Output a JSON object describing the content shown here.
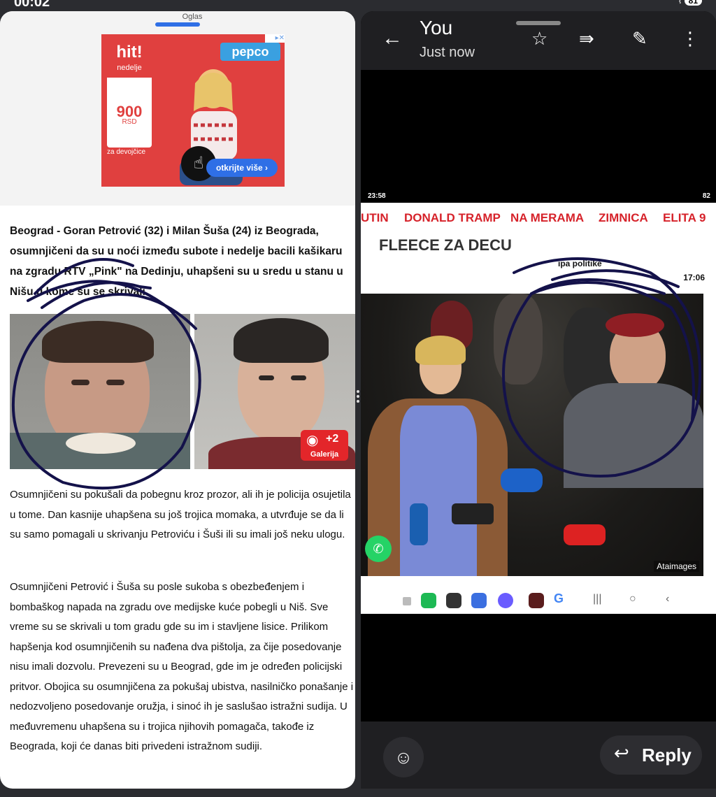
{
  "status": {
    "time": "00:02",
    "battery": "81"
  },
  "article": {
    "ad_label": "Oglas",
    "ad": {
      "brand": "hit!",
      "brand_sub": "nedelje",
      "price": "900",
      "currency": "RSD",
      "desc": "Praznični\ndžemper\nza devojčice",
      "retailer": "pepco",
      "cta": "otkrijte više ›"
    },
    "lead": "Beograd - Goran Petrović (32) i Milan Šuša (24) iz Beograda, osumnjičeni da su u noći između subote i nedelje bacili kašikaru na zgradu RTV „Pink\" na Dedinju, uhapšeni su u sredu u stanu u Nišu u kome su se skrivali.",
    "gallery": {
      "count": "+2",
      "label": "Galerija"
    },
    "para1": "Osumnjičeni su pokušali da pobegnu kroz prozor, ali ih je policija osujetila u tome. Dan kasnije uhapšena su još trojica momaka, a utvrđuje se da li su samo pomagali u skrivanju Petroviću i Šuši ili su imali još neku ulogu.",
    "para2": "Osumnjičeni Petrović i Šuša su posle sukoba s obezbeđenjem i bombaškog napada na zgradu ove medijske kuće pobegli u Niš. Sve vreme su se skrivali u tom gradu gde su im i stavljene lisice. Prilikom hapšenja kod osumnjičenih su nađena dva pištolja, za čije posedovanje nisu imali dozvolu. Prevezeni su u Beograd, gde im je određen policijski pritvor. Obojica su osumnjičena za pokušaj ubistva, nasilničko ponašanje i nedozvoljeno posedovanje oružja, i sinoć ih je saslušao istražni sudija. U međuvremenu uhapšena su i trojica njihovih pomagača, takođe iz Beograda, koji će danas biti privedeni istražnom sudiji."
  },
  "viewer": {
    "sender": "You",
    "time": "Just now",
    "icons": {
      "back": "back-arrow-icon",
      "star": "star-icon",
      "forward": "forward-icon",
      "edit": "pencil-icon",
      "more": "more-vert-icon"
    },
    "reply_label": "Reply"
  },
  "shot": {
    "time": "23:58",
    "battery": "82",
    "tags": [
      "UTIN",
      "DONALD TRAMP",
      "NA MERAMA",
      "ZIMNICA",
      "ELITA 9"
    ],
    "headline": "FLEECE ZA DECU",
    "section": "ipa politike",
    "date": "17:06",
    "credit": "Ataimages"
  }
}
